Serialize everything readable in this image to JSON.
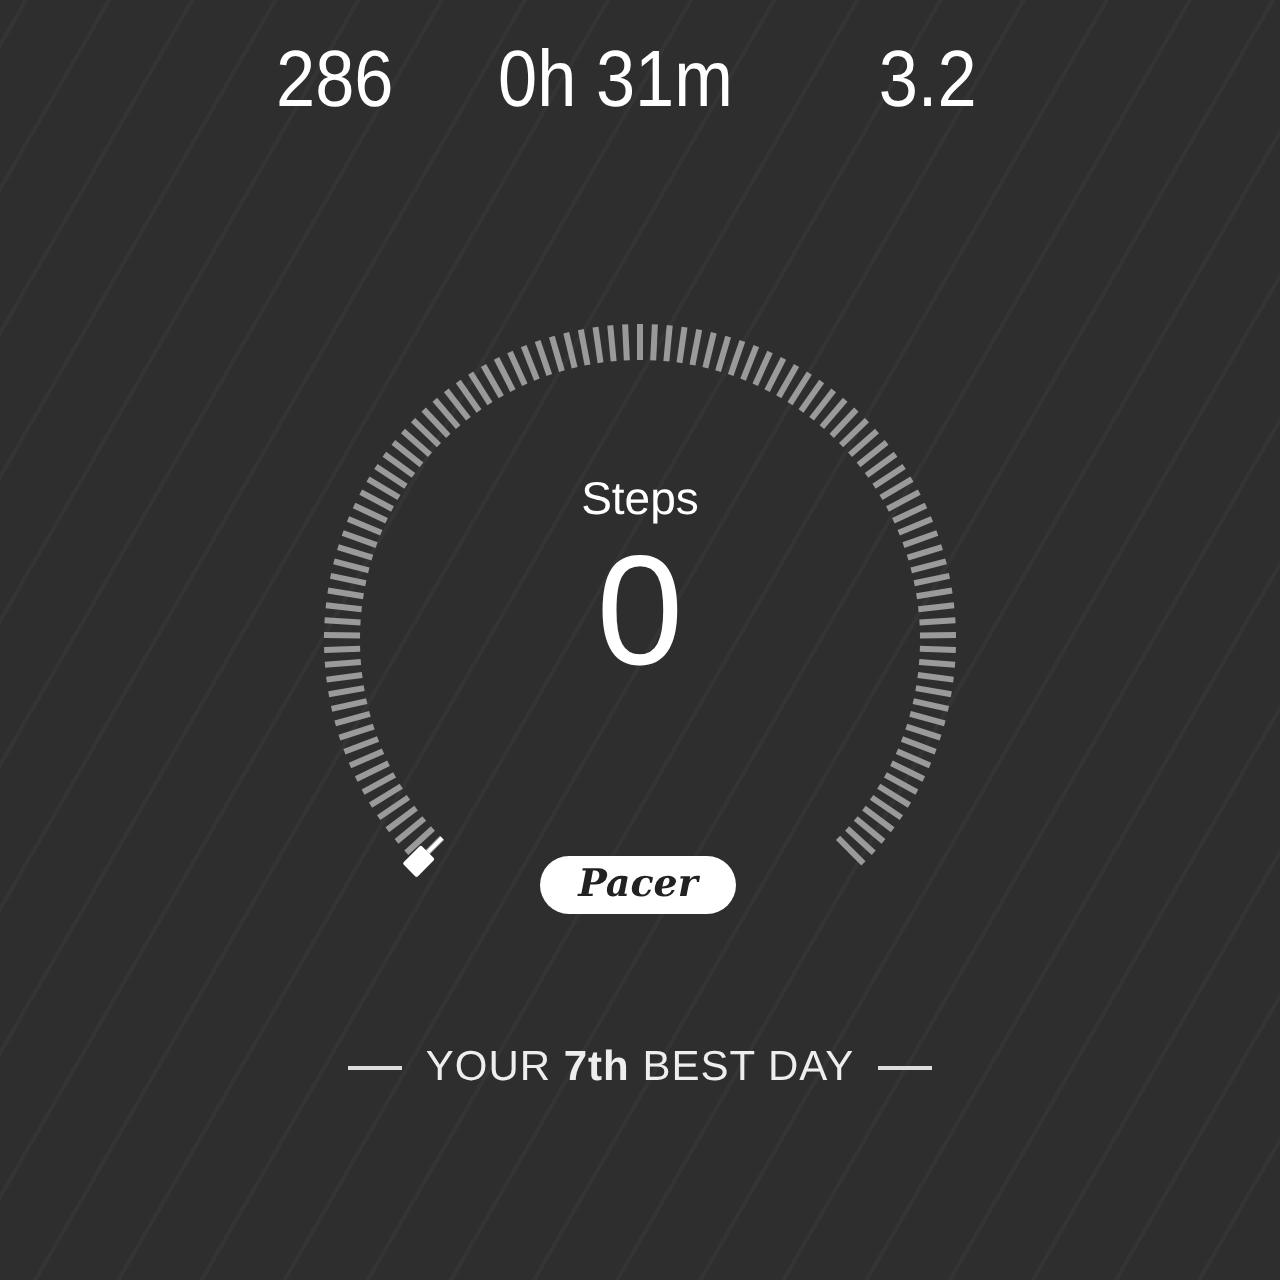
{
  "stats": [
    {
      "value": "286"
    },
    {
      "value": "0h 31m"
    },
    {
      "value": "3.2"
    }
  ],
  "gauge": {
    "label": "Steps",
    "value": "0",
    "badge": "Pacer"
  },
  "rank": {
    "text": "YOUR **7th** BEST DAY"
  }
}
